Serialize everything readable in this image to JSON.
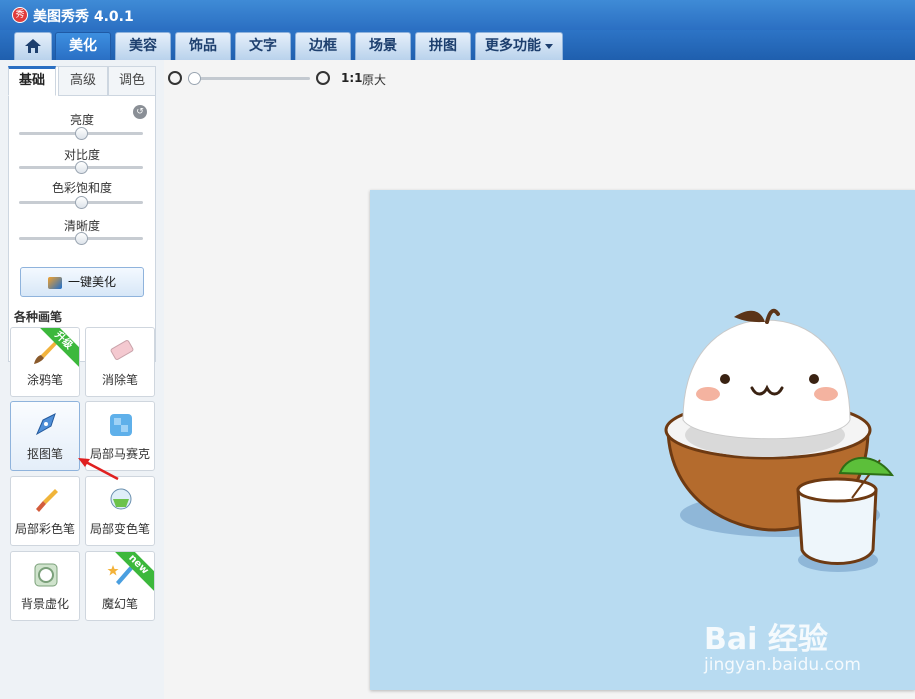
{
  "app": {
    "title": "美图秀秀 4.0.1",
    "logo_text": "秀"
  },
  "tabs": [
    "美化",
    "美容",
    "饰品",
    "文字",
    "边框",
    "场景",
    "拼图",
    "更多功能"
  ],
  "subtabs": [
    "基础",
    "高级",
    "调色"
  ],
  "sliders": [
    {
      "label": "亮度",
      "value": 0.5
    },
    {
      "label": "对比度",
      "value": 0.5
    },
    {
      "label": "色彩饱和度",
      "value": 0.5
    },
    {
      "label": "清晰度",
      "value": 0.5
    }
  ],
  "auto_beautify_label": "一键美化",
  "brushes": {
    "title": "各种画笔",
    "items": [
      {
        "label": "涂鸦笔",
        "badge": "升级"
      },
      {
        "label": "消除笔"
      },
      {
        "label": "抠图笔"
      },
      {
        "label": "局部马赛克"
      },
      {
        "label": "局部彩色笔"
      },
      {
        "label": "局部变色笔"
      },
      {
        "label": "背景虚化"
      },
      {
        "label": "魔幻笔",
        "badge": "new"
      }
    ]
  },
  "zoom": {
    "ratio": "1:1",
    "label": "原大",
    "level": 0
  },
  "watermark": {
    "text": "Bai 经验",
    "url": "jingyan.baidu.com"
  },
  "colors": {
    "accent": "#2b6fc2",
    "canvas_bg": "#b8dbf1"
  }
}
